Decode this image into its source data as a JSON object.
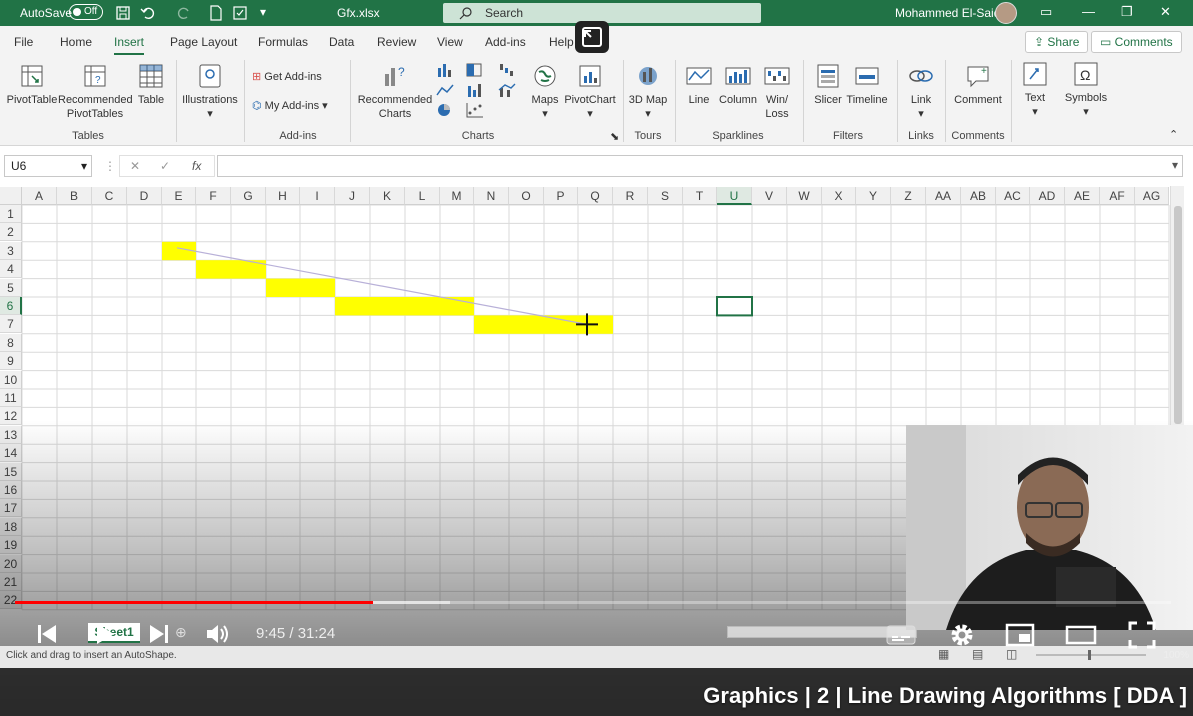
{
  "titlebar": {
    "autosave_label": "AutoSave",
    "autosave_state": "Off",
    "filename": "Gfx.xlsx",
    "search_placeholder": "Search",
    "user_name": "Mohammed El-Said",
    "colors": {
      "accent": "#217346"
    }
  },
  "tabs": [
    "File",
    "Home",
    "Insert",
    "Page Layout",
    "Formulas",
    "Data",
    "Review",
    "View",
    "Add-ins",
    "Help"
  ],
  "active_tab": "Insert",
  "share_label": "Share",
  "comments_label": "Comments",
  "ribbon": {
    "pivot_table": "PivotTable",
    "recommended_pivot": "Recommended PivotTables",
    "table": "Table",
    "tables_group": "Tables",
    "illustrations": "Illustrations",
    "get_addins": "Get Add-ins",
    "my_addins": "My Add-ins",
    "addins_group": "Add-ins",
    "recommended_charts": "Recommended Charts",
    "maps": "Maps",
    "pivot_chart": "PivotChart",
    "charts_group": "Charts",
    "map3d": "3D Map",
    "tours_group": "Tours",
    "line": "Line",
    "column": "Column",
    "winloss": "Win/ Loss",
    "sparklines_group": "Sparklines",
    "slicer": "Slicer",
    "timeline": "Timeline",
    "filters_group": "Filters",
    "link": "Link",
    "links_group": "Links",
    "comment": "Comment",
    "comments_group": "Comments",
    "text": "Text",
    "symbols": "Symbols"
  },
  "formula_bar": {
    "name_box": "U6",
    "fx": "fx",
    "content": ""
  },
  "grid": {
    "columns": [
      "A",
      "B",
      "C",
      "D",
      "E",
      "F",
      "G",
      "H",
      "I",
      "J",
      "K",
      "L",
      "M",
      "N",
      "O",
      "P",
      "Q",
      "R",
      "S",
      "T",
      "U",
      "V",
      "W",
      "X",
      "Y",
      "Z",
      "AA",
      "AB",
      "AC",
      "AD",
      "AE",
      "AF",
      "AG"
    ],
    "rows": [
      "1",
      "2",
      "3",
      "4",
      "5",
      "6",
      "7",
      "8",
      "9",
      "10",
      "11",
      "12",
      "13",
      "14",
      "15",
      "16",
      "17",
      "18",
      "19",
      "20",
      "21",
      "22"
    ],
    "selected_cell": "U6",
    "highlight_color": "#ffff00"
  },
  "player": {
    "time": "9:45 / 31:24",
    "sheet_tab": "Sheet1",
    "progress_fraction": 0.31
  },
  "status_text": "Click and drag to insert an AutoShape.",
  "zoom": "100%",
  "video_title": "Graphics | 2 | Line Drawing Algorithms [ DDA ]"
}
